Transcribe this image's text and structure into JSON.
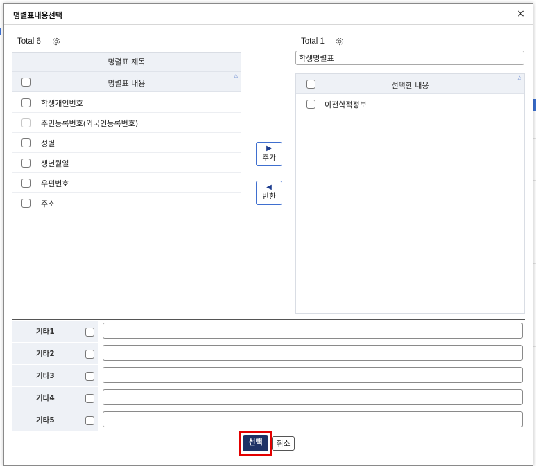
{
  "dialog": {
    "title": "명렬표내용선택",
    "close_label": "×"
  },
  "left_panel": {
    "total_label": "Total 6",
    "group_header": "명렬표 제목",
    "column_header": "명렬표 내용",
    "rows": [
      {
        "label": "학생개인번호",
        "disabled": false
      },
      {
        "label": "주민등록번호(외국인등록번호)",
        "disabled": true
      },
      {
        "label": "성별",
        "disabled": false
      },
      {
        "label": "생년월일",
        "disabled": false
      },
      {
        "label": "우편번호",
        "disabled": false
      },
      {
        "label": "주소",
        "disabled": false
      }
    ]
  },
  "right_panel": {
    "total_label": "Total 1",
    "title_input_value": "학생명렬표",
    "column_header": "선택한 내용",
    "rows": [
      {
        "label": "이전학적정보"
      }
    ]
  },
  "move_buttons": {
    "add_arrow": "▶",
    "add_label": "추가",
    "remove_arrow": "◀",
    "remove_label": "반환"
  },
  "etc_rows": [
    {
      "label": "기타1",
      "value": ""
    },
    {
      "label": "기타2",
      "value": ""
    },
    {
      "label": "기타3",
      "value": ""
    },
    {
      "label": "기타4",
      "value": ""
    },
    {
      "label": "기타5",
      "value": ""
    }
  ],
  "footer": {
    "select_label": "선택",
    "cancel_label": "취소"
  },
  "colors": {
    "accent": "#1e3266",
    "highlight": "#e30000",
    "header_bg": "#eef1f6"
  }
}
